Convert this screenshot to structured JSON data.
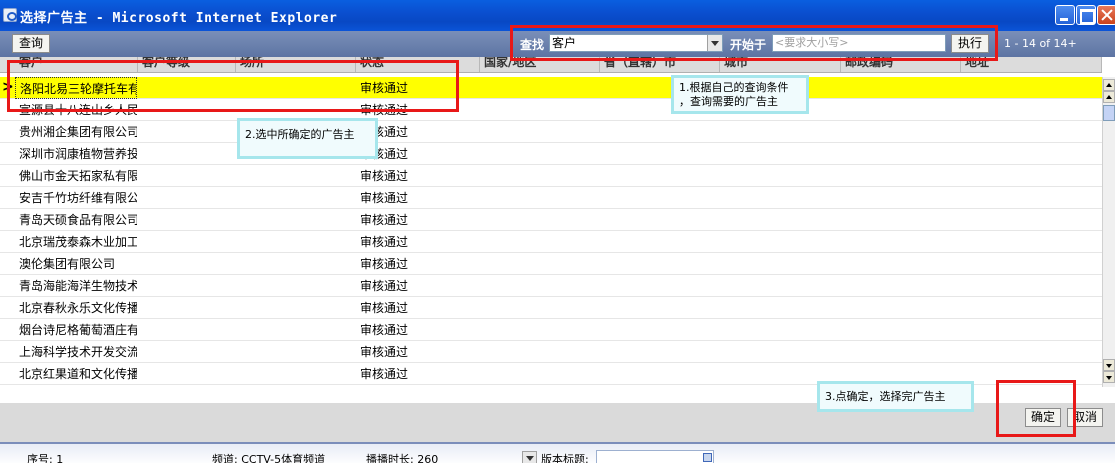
{
  "window": {
    "title": "选择广告主 - Microsoft Internet Explorer"
  },
  "toolbar": {
    "query_label": "查询",
    "find_label": "查找",
    "find_select_value": "客户",
    "start_label": "开始于",
    "start_placeholder": "<要求大小写>",
    "execute_label": "执行",
    "paging_text": "1 - 14 of 14+"
  },
  "grid": {
    "columns": [
      "客户",
      "客户等级",
      "场所",
      "状态",
      "国家/地区",
      "省（直辖）市",
      "城市",
      "邮政编码",
      "地址"
    ],
    "rows": [
      {
        "customer": "洛阳北易三轮摩托车有",
        "status": "审核通过",
        "selected": true
      },
      {
        "customer": "宣源县十八连山乡人民",
        "status": "审核通过"
      },
      {
        "customer": "贵州湘企集团有限公司",
        "status": "审核通过"
      },
      {
        "customer": "深圳市润康植物营养投",
        "status": "审核通过"
      },
      {
        "customer": "佛山市金天拓家私有限",
        "status": "审核通过"
      },
      {
        "customer": "安吉千竹坊纤维有限公",
        "status": "审核通过"
      },
      {
        "customer": "青岛天硕食品有限公司",
        "status": "审核通过"
      },
      {
        "customer": "北京瑞茂泰森木业加工",
        "status": "审核通过"
      },
      {
        "customer": "澳伦集团有限公司",
        "status": "审核通过"
      },
      {
        "customer": "青岛海能海洋生物技术",
        "status": "审核通过"
      },
      {
        "customer": "北京春秋永乐文化传播",
        "status": "审核通过"
      },
      {
        "customer": "烟台诗尼格葡萄酒庄有",
        "status": "审核通过"
      },
      {
        "customer": "上海科学技术开发交流",
        "status": "审核通过"
      },
      {
        "customer": "北京红果道和文化传播",
        "status": "审核通过"
      }
    ]
  },
  "dialog": {
    "ok_label": "确定",
    "cancel_label": "取消"
  },
  "statusbar": {
    "serial": "序号: 1",
    "channel": "频道: CCTV-5体育频道",
    "duration": "播播时长: 260",
    "version_label": "版本标题:"
  },
  "annotations": {
    "step1_line1": "1.根据自己的查询条件",
    "step1_line2": "，查询需要的广告主",
    "step2": "2.选中所确定的广告主",
    "step3": "3.点确定，选择完广告主"
  },
  "colors": {
    "selected_row": "#ffff00",
    "annotation_box": "#e81818",
    "callout_border": "#a6e6ec"
  }
}
